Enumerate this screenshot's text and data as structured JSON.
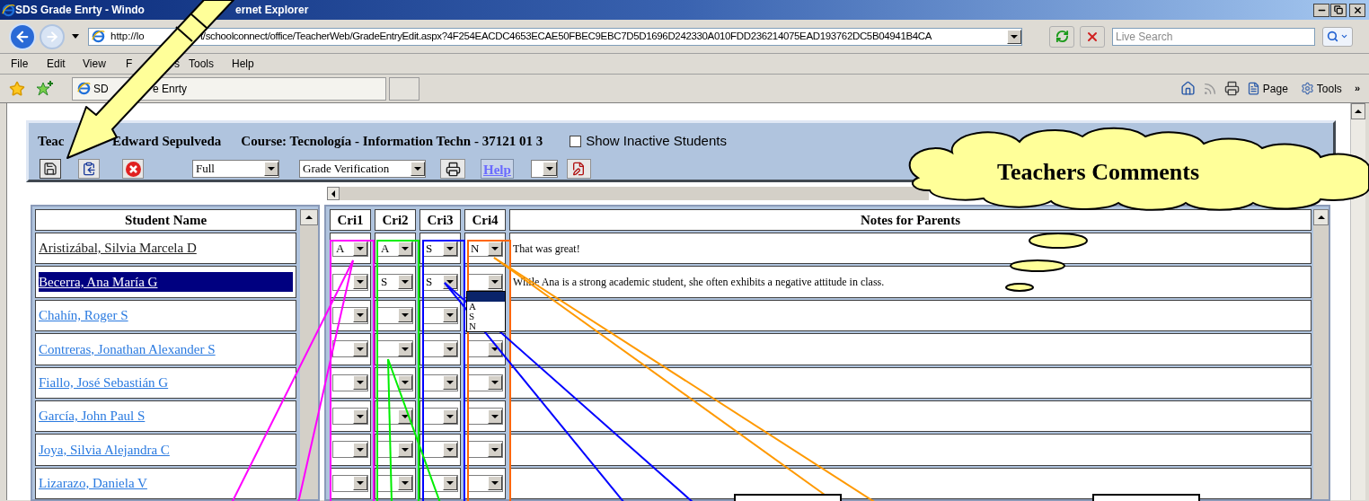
{
  "window": {
    "title_parts": [
      "SDS Grade Enrty - Windo",
      "ernet Explorer"
    ]
  },
  "address_bar": {
    "url_parts": [
      "http://lo",
      "t/schoolconnect/office/TeacherWeb/GradeEntryEdit.aspx?4F254EACDC4653ECAE50FBEC9EBC7D5D1696D242330A010FDD236214075EAD193762DC5B04941B4CA"
    ]
  },
  "search": {
    "placeholder": "Live Search"
  },
  "menu": [
    {
      "parts": [
        "File"
      ]
    },
    {
      "parts": [
        "Edit"
      ]
    },
    {
      "parts": [
        "View"
      ]
    },
    {
      "parts": [
        "F",
        "s"
      ]
    },
    {
      "parts": [
        "Tools"
      ]
    },
    {
      "parts": [
        "Help"
      ]
    }
  ],
  "browser_tab": {
    "label_parts": [
      "SD",
      "e Enrty"
    ]
  },
  "command_bar": {
    "page": "Page",
    "tools": "Tools",
    "more": "»"
  },
  "page_header": {
    "teacher_parts": [
      "Teac",
      "Edward Sepulveda"
    ],
    "course": "Course: Tecnología - Information Techn - 37121 01 3",
    "show_inactive": {
      "label": "Show Inactive Students",
      "checked": false
    },
    "view_select": "Full",
    "report_select": "Grade Verification",
    "help_link": "Help"
  },
  "grid": {
    "name_header": "Student Name",
    "criteria": [
      "Cri1",
      "Cri2",
      "Cri3",
      "Cri4"
    ],
    "notes_header": "Notes for Parents",
    "rows": [
      {
        "name": "Aristizábal, Silvia Marcela D",
        "visited": true,
        "selected": false,
        "grades": [
          {
            "kind": "select",
            "value": "A"
          },
          {
            "kind": "select",
            "value": "A"
          },
          {
            "kind": "select",
            "value": "S"
          },
          {
            "kind": "select",
            "value": "N"
          }
        ],
        "note": "That was great!"
      },
      {
        "name": "Becerra, Ana María G",
        "visited": true,
        "selected": true,
        "grades": [
          {
            "kind": "select"
          },
          {
            "kind": "select",
            "value": "S"
          },
          {
            "kind": "select",
            "value": "S"
          },
          {
            "kind": "open",
            "options": [
              {
                "kind": "blank",
                "selected": true
              },
              {
                "kind": "grade",
                "label": "A",
                "selected": false
              },
              {
                "kind": "grade",
                "label": "S",
                "selected": false
              },
              {
                "kind": "grade",
                "label": "N",
                "selected": false
              }
            ]
          }
        ],
        "note": "While Ana is a strong academic student, she often exhibits a negative attitude in class."
      },
      {
        "name": "Chahín, Roger S",
        "visited": false,
        "selected": false,
        "grades": [
          {
            "kind": "select"
          },
          {
            "kind": "select"
          },
          {
            "kind": "select"
          }
        ]
      },
      {
        "name": "Contreras, Jonathan Alexander S",
        "visited": false,
        "selected": false,
        "grades": [
          {
            "kind": "select"
          },
          {
            "kind": "select"
          },
          {
            "kind": "select"
          },
          {
            "kind": "select"
          }
        ]
      },
      {
        "name": "Fiallo, José Sebastián G",
        "visited": false,
        "selected": false,
        "grades": [
          {
            "kind": "select"
          },
          {
            "kind": "select"
          },
          {
            "kind": "select"
          },
          {
            "kind": "select"
          }
        ]
      },
      {
        "name": "García, John Paul S",
        "visited": false,
        "selected": false,
        "grades": [
          {
            "kind": "select"
          },
          {
            "kind": "select"
          },
          {
            "kind": "select"
          },
          {
            "kind": "select"
          }
        ]
      },
      {
        "name": "Joya, Silvia Alejandra C",
        "visited": false,
        "selected": false,
        "grades": [
          {
            "kind": "select"
          },
          {
            "kind": "select"
          },
          {
            "kind": "select"
          },
          {
            "kind": "select"
          }
        ]
      },
      {
        "name": "Lizarazo, Daniela V",
        "visited": false,
        "selected": false,
        "grades": [
          {
            "kind": "select"
          },
          {
            "kind": "select"
          },
          {
            "kind": "select"
          },
          {
            "kind": "select"
          }
        ]
      }
    ]
  },
  "annotation": {
    "cloud_text": "Teachers Comments"
  }
}
